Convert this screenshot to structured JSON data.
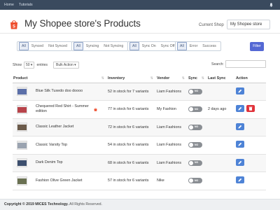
{
  "nav": {
    "items": [
      "Home",
      "Tutorials"
    ]
  },
  "header": {
    "title": "My Shopee store's Products",
    "current_shop_label": "Current Shop",
    "current_shop_value": "My Shopee store"
  },
  "filters": {
    "sync_group": [
      "All",
      "Synced",
      "Not Synced"
    ],
    "syncing_group": [
      "All",
      "Syncing",
      "Not Syncing"
    ],
    "sync_state_group": [
      "All",
      "Sync On",
      "Sync Off"
    ],
    "status_group": [
      "All",
      "Error",
      "Success"
    ],
    "filter_button": "Filter"
  },
  "table_controls": {
    "show_label": "Show",
    "entries_value": "50",
    "entries_label": "entries",
    "bulk_action": "Bulk Action",
    "search_label": "Search:"
  },
  "columns": {
    "product": "Product",
    "inventory": "Inventory",
    "vendor": "Vendor",
    "sync": "Sync",
    "last_sync": "Last Sync",
    "action": "Action"
  },
  "rows": [
    {
      "product": "Blue Silk Tuxedo doo doooo",
      "inventory": "52 in stock for 7 variants",
      "vendor": "Liam Fashions",
      "sync": "NO",
      "last_sync": "",
      "thumb_color": "#5b6fa8"
    },
    {
      "product": "Chequered Red Shirt - Summer edition",
      "inventory": "77 in stock for 6 variants",
      "vendor": "My Fashion",
      "sync": "NO",
      "last_sync": "2 days ago",
      "thumb_color": "#b8434a"
    },
    {
      "product": "Classic Leather Jacket",
      "inventory": "72 in stock for 6 variants",
      "vendor": "Liam Fashions",
      "sync": "NO",
      "last_sync": "",
      "thumb_color": "#6b5a4a"
    },
    {
      "product": "Classic Varsity Top",
      "inventory": "54 in stock for 6 variants",
      "vendor": "Liam Fashions",
      "sync": "NO",
      "last_sync": "",
      "thumb_color": "#9aa3b0"
    },
    {
      "product": "Dark Denim Top",
      "inventory": "68 in stock for 6 variants",
      "vendor": "Liam Fashions",
      "sync": "NO",
      "last_sync": "",
      "thumb_color": "#3d4f6e"
    },
    {
      "product": "Fashion Olive Green Jacket",
      "inventory": "57 in stock for 6 variants",
      "vendor": "Nike",
      "sync": "NO",
      "last_sync": "",
      "thumb_color": "#6a7152"
    }
  ],
  "footer": {
    "prefix": "Copyright © 2019",
    "company": "MICES Technology.",
    "suffix": "All Rights Reserved."
  },
  "colors": {
    "topnav": "#3a4a5e",
    "filter_button": "#5468d4",
    "edit": "#4e83d6",
    "delete": "#e0333b",
    "shopee": "#ee4d2d"
  }
}
